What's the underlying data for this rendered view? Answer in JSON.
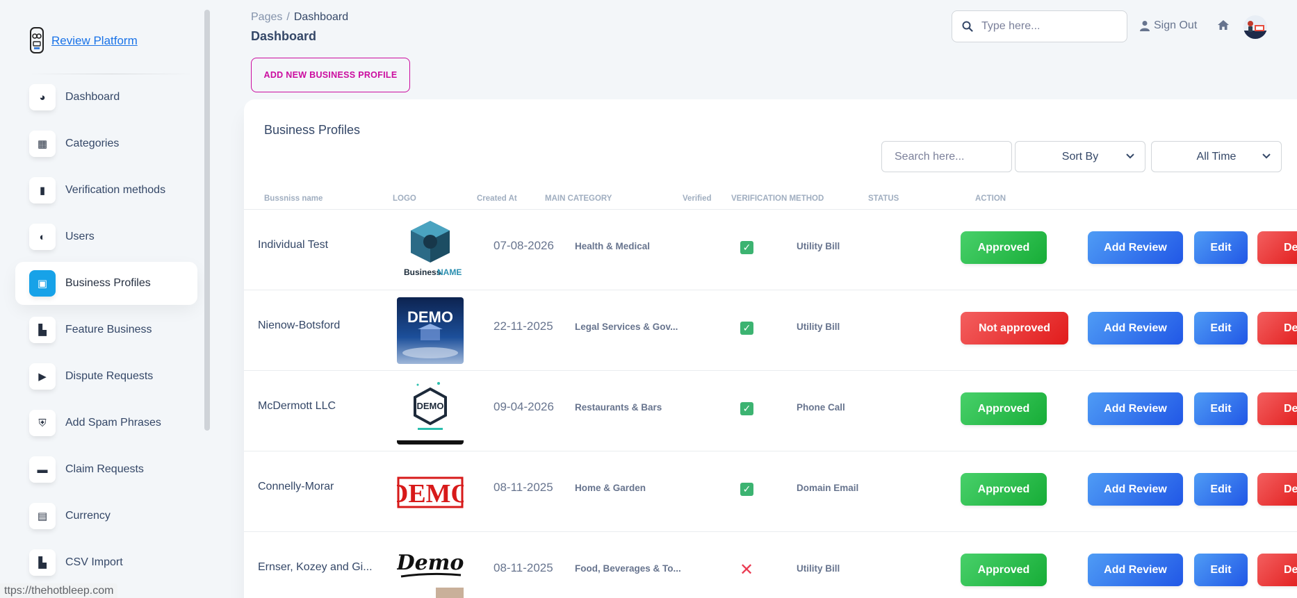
{
  "brand": {
    "name": "Review Platform"
  },
  "sidebar": {
    "items": [
      {
        "label": "Dashboard",
        "icon": "pie-chart-icon",
        "glyph": "◕"
      },
      {
        "label": "Categories",
        "icon": "grid-icon",
        "glyph": "▦"
      },
      {
        "label": "Verification methods",
        "icon": "document-icon",
        "glyph": "▮"
      },
      {
        "label": "Users",
        "icon": "users-icon",
        "glyph": "◐"
      },
      {
        "label": "Business Profiles",
        "icon": "profile-card-icon",
        "glyph": "▣",
        "active": true
      },
      {
        "label": "Feature Business",
        "icon": "chart-icon",
        "glyph": "▙"
      },
      {
        "label": "Dispute Requests",
        "icon": "play-icon",
        "glyph": "▶"
      },
      {
        "label": "Add Spam Phrases",
        "icon": "shield-icon",
        "glyph": "⛨"
      },
      {
        "label": "Claim Requests",
        "icon": "laptop-icon",
        "glyph": "▬"
      },
      {
        "label": "Currency",
        "icon": "shop-icon",
        "glyph": "▤"
      },
      {
        "label": "CSV Import",
        "icon": "import-icon",
        "glyph": "▙"
      }
    ]
  },
  "status_url": "ttps://thehotbleep.com",
  "header": {
    "breadcrumb_root": "Pages",
    "breadcrumb_sep": "/",
    "breadcrumb_current": "Dashboard",
    "title": "Dashboard",
    "search_placeholder": "Type here...",
    "sign_out": "Sign Out"
  },
  "add_button": "ADD NEW BUSINESS PROFILE",
  "card": {
    "title": "Business Profiles",
    "search_placeholder": "Search here...",
    "sort_label": "Sort By",
    "time_label": "All Time"
  },
  "columns": [
    "Bussniss name",
    "LOGO",
    "Created At",
    "MAIN CATEGORY",
    "Verified",
    "VERIFICATION METHOD",
    "STATUS",
    "ACTION"
  ],
  "actions": {
    "add_review": "Add Review",
    "edit": "Edit",
    "delete": "Dele"
  },
  "rows": [
    {
      "name": "Individual Test",
      "logo": "business-name-logo",
      "created": "07-08-2026",
      "category": "Health & Medical",
      "verified": true,
      "method": "Utility Bill",
      "status": "Approved",
      "approved": true
    },
    {
      "name": "Nienow-Botsford",
      "logo": "demo-blue-logo",
      "created": "22-11-2025",
      "category": "Legal Services & Gov...",
      "verified": true,
      "method": "Utility Bill",
      "status": "Not approved",
      "approved": false
    },
    {
      "name": "McDermott LLC",
      "logo": "demo-hexagon-logo",
      "created": "09-04-2026",
      "category": "Restaurants & Bars",
      "verified": true,
      "method": "Phone Call",
      "status": "Approved",
      "approved": true
    },
    {
      "name": "Connelly-Morar",
      "logo": "demo-stamp-logo",
      "created": "08-11-2025",
      "category": "Home & Garden",
      "verified": true,
      "method": "Domain Email",
      "status": "Approved",
      "approved": true
    },
    {
      "name": "Ernser, Kozey and Gi...",
      "logo": "demo-handwritten-logo",
      "created": "08-11-2025",
      "category": "Food, Beverages & To...",
      "verified": false,
      "method": "Utility Bill",
      "status": "Approved",
      "approved": true
    }
  ],
  "logo_text": {
    "business_name_1": "Business",
    "business_name_2": "NAME",
    "demo": "DEMO",
    "demo_script": "Demo"
  }
}
